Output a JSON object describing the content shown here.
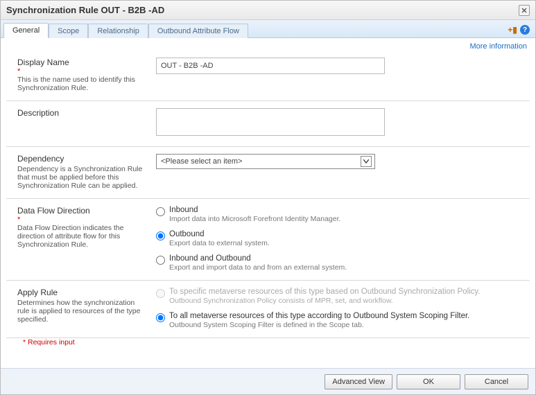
{
  "title": "Synchronization Rule OUT - B2B -AD",
  "tabs": [
    {
      "label": "General",
      "active": true
    },
    {
      "label": "Scope",
      "active": false
    },
    {
      "label": "Relationship",
      "active": false
    },
    {
      "label": "Outbound Attribute Flow",
      "active": false
    }
  ],
  "moreInfo": "More information",
  "sections": {
    "displayName": {
      "label": "Display Name",
      "desc": "This is the name used to identify this Synchronization Rule.",
      "value": "OUT - B2B -AD"
    },
    "description": {
      "label": "Description",
      "value": ""
    },
    "dependency": {
      "label": "Dependency",
      "desc": "Dependency is a Synchronization Rule that must be applied before this Synchronization Rule can be applied.",
      "placeholder": "<Please select an item>"
    },
    "dataFlow": {
      "label": "Data Flow Direction",
      "desc": "Data Flow Direction indicates the direction of attribute flow for this Synchronization Rule.",
      "options": [
        {
          "label": "Inbound",
          "sub": "Import data into Microsoft Forefront Identity Manager.",
          "selected": false
        },
        {
          "label": "Outbound",
          "sub": "Export data to external system.",
          "selected": true
        },
        {
          "label": "Inbound and Outbound",
          "sub": "Export and import data to and from an external system.",
          "selected": false
        }
      ]
    },
    "applyRule": {
      "label": "Apply Rule",
      "desc": "Determines how the synchronization rule is applied to resources of the type specified.",
      "options": [
        {
          "label": "To specific metaverse resources of this type based on Outbound Synchronization Policy.",
          "sub": "Outbound Synchronization Policy consists of MPR, set, and workflow.",
          "selected": false,
          "disabled": true
        },
        {
          "label": "To all metaverse resources of this type according to Outbound System Scoping Filter.",
          "sub": "Outbound System Scoping Filter is defined in the Scope tab.",
          "selected": true,
          "disabled": false
        }
      ]
    }
  },
  "footnote": "* Requires input",
  "buttons": {
    "advanced": "Advanced View",
    "ok": "OK",
    "cancel": "Cancel"
  }
}
